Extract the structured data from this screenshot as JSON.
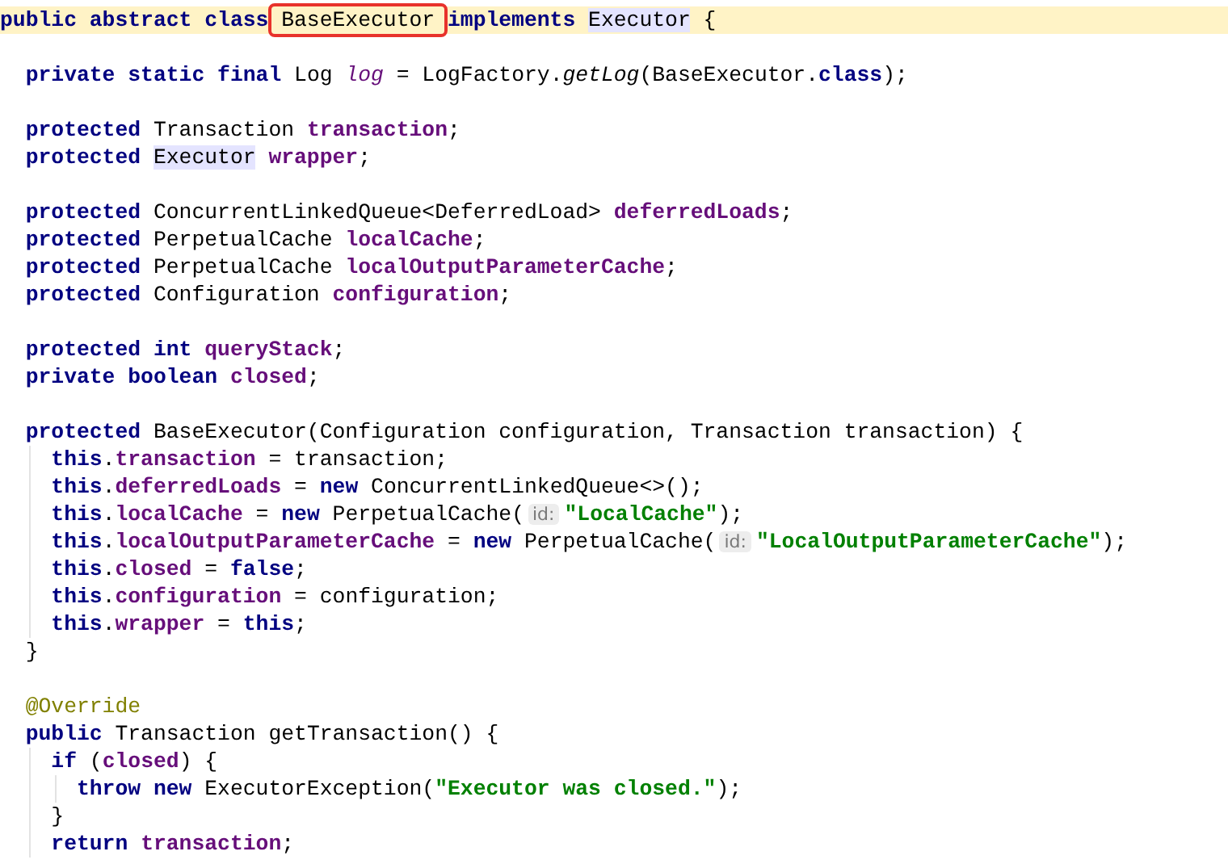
{
  "editor": {
    "lines": [
      {
        "kind": "code",
        "current": true,
        "tokens": [
          {
            "t": "public abstract class ",
            "kind": "kw",
            "boxed": false
          },
          {
            "t": "BaseExecutor",
            "kind": "plain",
            "boxed": true
          },
          {
            "t": " implements ",
            "kind": "kw",
            "boxed": false
          },
          {
            "t": "Executor",
            "kind": "usage",
            "boxed": false
          },
          {
            "t": " {",
            "kind": "plain",
            "boxed": false
          }
        ]
      },
      {
        "kind": "blank"
      },
      {
        "kind": "code",
        "current": false,
        "tokens": [
          {
            "t": "  private static final ",
            "kind": "kw"
          },
          {
            "t": "Log ",
            "kind": "plain"
          },
          {
            "t": "log",
            "kind": "static"
          },
          {
            "t": " = LogFactory.",
            "kind": "plain"
          },
          {
            "t": "getLog",
            "kind": "smethod"
          },
          {
            "t": "(BaseExecutor.",
            "kind": "plain"
          },
          {
            "t": "class",
            "kind": "kw"
          },
          {
            "t": ");",
            "kind": "plain"
          }
        ]
      },
      {
        "kind": "blank"
      },
      {
        "kind": "code",
        "current": false,
        "tokens": [
          {
            "t": "  protected ",
            "kind": "kw"
          },
          {
            "t": "Transaction ",
            "kind": "plain"
          },
          {
            "t": "transaction",
            "kind": "field"
          },
          {
            "t": ";",
            "kind": "plain"
          }
        ]
      },
      {
        "kind": "code",
        "current": false,
        "tokens": [
          {
            "t": "  protected ",
            "kind": "kw"
          },
          {
            "t": "Executor",
            "kind": "usage"
          },
          {
            "t": " wrapper",
            "kind": "field"
          },
          {
            "t": ";",
            "kind": "plain"
          }
        ]
      },
      {
        "kind": "blank"
      },
      {
        "kind": "code",
        "current": false,
        "tokens": [
          {
            "t": "  protected ",
            "kind": "kw"
          },
          {
            "t": "ConcurrentLinkedQueue<DeferredLoad> ",
            "kind": "plain"
          },
          {
            "t": "deferredLoads",
            "kind": "field"
          },
          {
            "t": ";",
            "kind": "plain"
          }
        ]
      },
      {
        "kind": "code",
        "current": false,
        "tokens": [
          {
            "t": "  protected ",
            "kind": "kw"
          },
          {
            "t": "PerpetualCache ",
            "kind": "plain"
          },
          {
            "t": "localCache",
            "kind": "field"
          },
          {
            "t": ";",
            "kind": "plain"
          }
        ]
      },
      {
        "kind": "code",
        "current": false,
        "tokens": [
          {
            "t": "  protected ",
            "kind": "kw"
          },
          {
            "t": "PerpetualCache ",
            "kind": "plain"
          },
          {
            "t": "localOutputParameterCache",
            "kind": "field"
          },
          {
            "t": ";",
            "kind": "plain"
          }
        ]
      },
      {
        "kind": "code",
        "current": false,
        "tokens": [
          {
            "t": "  protected ",
            "kind": "kw"
          },
          {
            "t": "Configuration ",
            "kind": "plain"
          },
          {
            "t": "configuration",
            "kind": "field"
          },
          {
            "t": ";",
            "kind": "plain"
          }
        ]
      },
      {
        "kind": "blank"
      },
      {
        "kind": "code",
        "current": false,
        "tokens": [
          {
            "t": "  protected int ",
            "kind": "kw"
          },
          {
            "t": "queryStack",
            "kind": "field"
          },
          {
            "t": ";",
            "kind": "plain"
          }
        ]
      },
      {
        "kind": "code",
        "current": false,
        "tokens": [
          {
            "t": "  private boolean ",
            "kind": "kw"
          },
          {
            "t": "closed",
            "kind": "field"
          },
          {
            "t": ";",
            "kind": "plain"
          }
        ]
      },
      {
        "kind": "blank"
      },
      {
        "kind": "code",
        "current": false,
        "tokens": [
          {
            "t": "  protected ",
            "kind": "kw"
          },
          {
            "t": "BaseExecutor(Configuration configuration, Transaction transaction) {",
            "kind": "plain"
          }
        ]
      },
      {
        "kind": "code",
        "current": false,
        "tokens": [
          {
            "t": "    this",
            "kind": "kw"
          },
          {
            "t": ".",
            "kind": "plain"
          },
          {
            "t": "transaction",
            "kind": "field"
          },
          {
            "t": " = transaction;",
            "kind": "plain"
          }
        ]
      },
      {
        "kind": "code",
        "current": false,
        "tokens": [
          {
            "t": "    this",
            "kind": "kw"
          },
          {
            "t": ".",
            "kind": "plain"
          },
          {
            "t": "deferredLoads",
            "kind": "field"
          },
          {
            "t": " = ",
            "kind": "plain"
          },
          {
            "t": "new ",
            "kind": "kw"
          },
          {
            "t": "ConcurrentLinkedQueue<>();",
            "kind": "plain"
          }
        ]
      },
      {
        "kind": "code",
        "current": false,
        "tokens": [
          {
            "t": "    this",
            "kind": "kw"
          },
          {
            "t": ".",
            "kind": "plain"
          },
          {
            "t": "localCache",
            "kind": "field"
          },
          {
            "t": " = ",
            "kind": "plain"
          },
          {
            "t": "new ",
            "kind": "kw"
          },
          {
            "t": "PerpetualCache(",
            "kind": "plain"
          },
          {
            "t": "id:",
            "kind": "hint"
          },
          {
            "t": "\"LocalCache\"",
            "kind": "string"
          },
          {
            "t": ");",
            "kind": "plain"
          }
        ]
      },
      {
        "kind": "code",
        "current": false,
        "tokens": [
          {
            "t": "    this",
            "kind": "kw"
          },
          {
            "t": ".",
            "kind": "plain"
          },
          {
            "t": "localOutputParameterCache",
            "kind": "field"
          },
          {
            "t": " = ",
            "kind": "plain"
          },
          {
            "t": "new ",
            "kind": "kw"
          },
          {
            "t": "PerpetualCache(",
            "kind": "plain"
          },
          {
            "t": "id:",
            "kind": "hint"
          },
          {
            "t": "\"LocalOutputParameterCache\"",
            "kind": "string"
          },
          {
            "t": ");",
            "kind": "plain"
          }
        ]
      },
      {
        "kind": "code",
        "current": false,
        "tokens": [
          {
            "t": "    this",
            "kind": "kw"
          },
          {
            "t": ".",
            "kind": "plain"
          },
          {
            "t": "closed",
            "kind": "field"
          },
          {
            "t": " = ",
            "kind": "plain"
          },
          {
            "t": "false",
            "kind": "kw"
          },
          {
            "t": ";",
            "kind": "plain"
          }
        ]
      },
      {
        "kind": "code",
        "current": false,
        "tokens": [
          {
            "t": "    this",
            "kind": "kw"
          },
          {
            "t": ".",
            "kind": "plain"
          },
          {
            "t": "configuration",
            "kind": "field"
          },
          {
            "t": " = configuration;",
            "kind": "plain"
          }
        ]
      },
      {
        "kind": "code",
        "current": false,
        "tokens": [
          {
            "t": "    this",
            "kind": "kw"
          },
          {
            "t": ".",
            "kind": "plain"
          },
          {
            "t": "wrapper",
            "kind": "field"
          },
          {
            "t": " = ",
            "kind": "plain"
          },
          {
            "t": "this",
            "kind": "kw"
          },
          {
            "t": ";",
            "kind": "plain"
          }
        ]
      },
      {
        "kind": "code",
        "current": false,
        "tokens": [
          {
            "t": "  }",
            "kind": "plain"
          }
        ]
      },
      {
        "kind": "blank"
      },
      {
        "kind": "code",
        "current": false,
        "tokens": [
          {
            "t": "  @Override",
            "kind": "annotation"
          }
        ]
      },
      {
        "kind": "code",
        "current": false,
        "tokens": [
          {
            "t": "  public ",
            "kind": "kw"
          },
          {
            "t": "Transaction getTransaction() {",
            "kind": "plain"
          }
        ]
      },
      {
        "kind": "code",
        "current": false,
        "tokens": [
          {
            "t": "    if ",
            "kind": "kw"
          },
          {
            "t": "(",
            "kind": "plain"
          },
          {
            "t": "closed",
            "kind": "field"
          },
          {
            "t": ") {",
            "kind": "plain"
          }
        ]
      },
      {
        "kind": "code",
        "current": false,
        "tokens": [
          {
            "t": "      throw new ",
            "kind": "kw"
          },
          {
            "t": "ExecutorException(",
            "kind": "plain"
          },
          {
            "t": "\"Executor was closed.\"",
            "kind": "string"
          },
          {
            "t": ");",
            "kind": "plain"
          }
        ]
      },
      {
        "kind": "code",
        "current": false,
        "tokens": [
          {
            "t": "    }",
            "kind": "plain"
          }
        ]
      },
      {
        "kind": "code",
        "current": false,
        "tokens": [
          {
            "t": "    return ",
            "kind": "kw"
          },
          {
            "t": "transaction",
            "kind": "field"
          },
          {
            "t": ";",
            "kind": "plain"
          }
        ]
      }
    ]
  }
}
